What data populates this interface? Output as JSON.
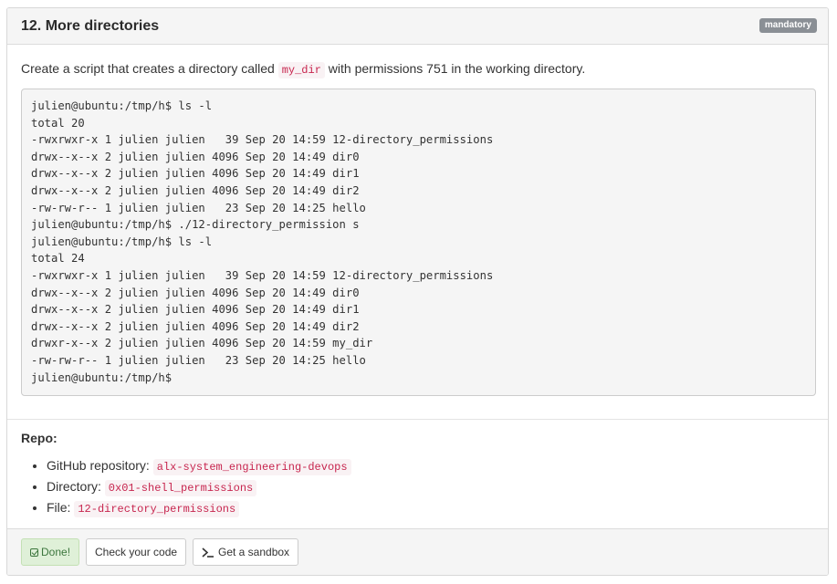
{
  "task": {
    "title": "12. More directories",
    "badge": "mandatory",
    "description_before": "Create a script that creates a directory called ",
    "description_code": "my_dir",
    "description_after": " with permissions 751 in the working directory.",
    "terminal_output": "julien@ubuntu:/tmp/h$ ls -l\ntotal 20\n-rwxrwxr-x 1 julien julien   39 Sep 20 14:59 12-directory_permissions\ndrwx--x--x 2 julien julien 4096 Sep 20 14:49 dir0\ndrwx--x--x 2 julien julien 4096 Sep 20 14:49 dir1\ndrwx--x--x 2 julien julien 4096 Sep 20 14:49 dir2\n-rw-rw-r-- 1 julien julien   23 Sep 20 14:25 hello\njulien@ubuntu:/tmp/h$ ./12-directory_permission s\njulien@ubuntu:/tmp/h$ ls -l\ntotal 24\n-rwxrwxr-x 1 julien julien   39 Sep 20 14:59 12-directory_permissions\ndrwx--x--x 2 julien julien 4096 Sep 20 14:49 dir0\ndrwx--x--x 2 julien julien 4096 Sep 20 14:49 dir1\ndrwx--x--x 2 julien julien 4096 Sep 20 14:49 dir2\ndrwxr-x--x 2 julien julien 4096 Sep 20 14:59 my_dir\n-rw-rw-r-- 1 julien julien   23 Sep 20 14:25 hello\njulien@ubuntu:/tmp/h$"
  },
  "repo": {
    "title": "Repo:",
    "items": [
      {
        "label": "GitHub repository: ",
        "value": "alx-system_engineering-devops"
      },
      {
        "label": "Directory: ",
        "value": "0x01-shell_permissions"
      },
      {
        "label": "File: ",
        "value": "12-directory_permissions"
      }
    ]
  },
  "footer": {
    "done_label": "Done!",
    "check_label": "Check your code",
    "sandbox_label": "Get a sandbox"
  },
  "colors": {
    "badge_bg": "#8a8f95",
    "code_text": "#c7254e",
    "done_bg": "#dff0d8",
    "done_text": "#3c763d"
  },
  "icons": {
    "done": "checkbox-checked-icon",
    "sandbox": "terminal-prompt-icon"
  }
}
